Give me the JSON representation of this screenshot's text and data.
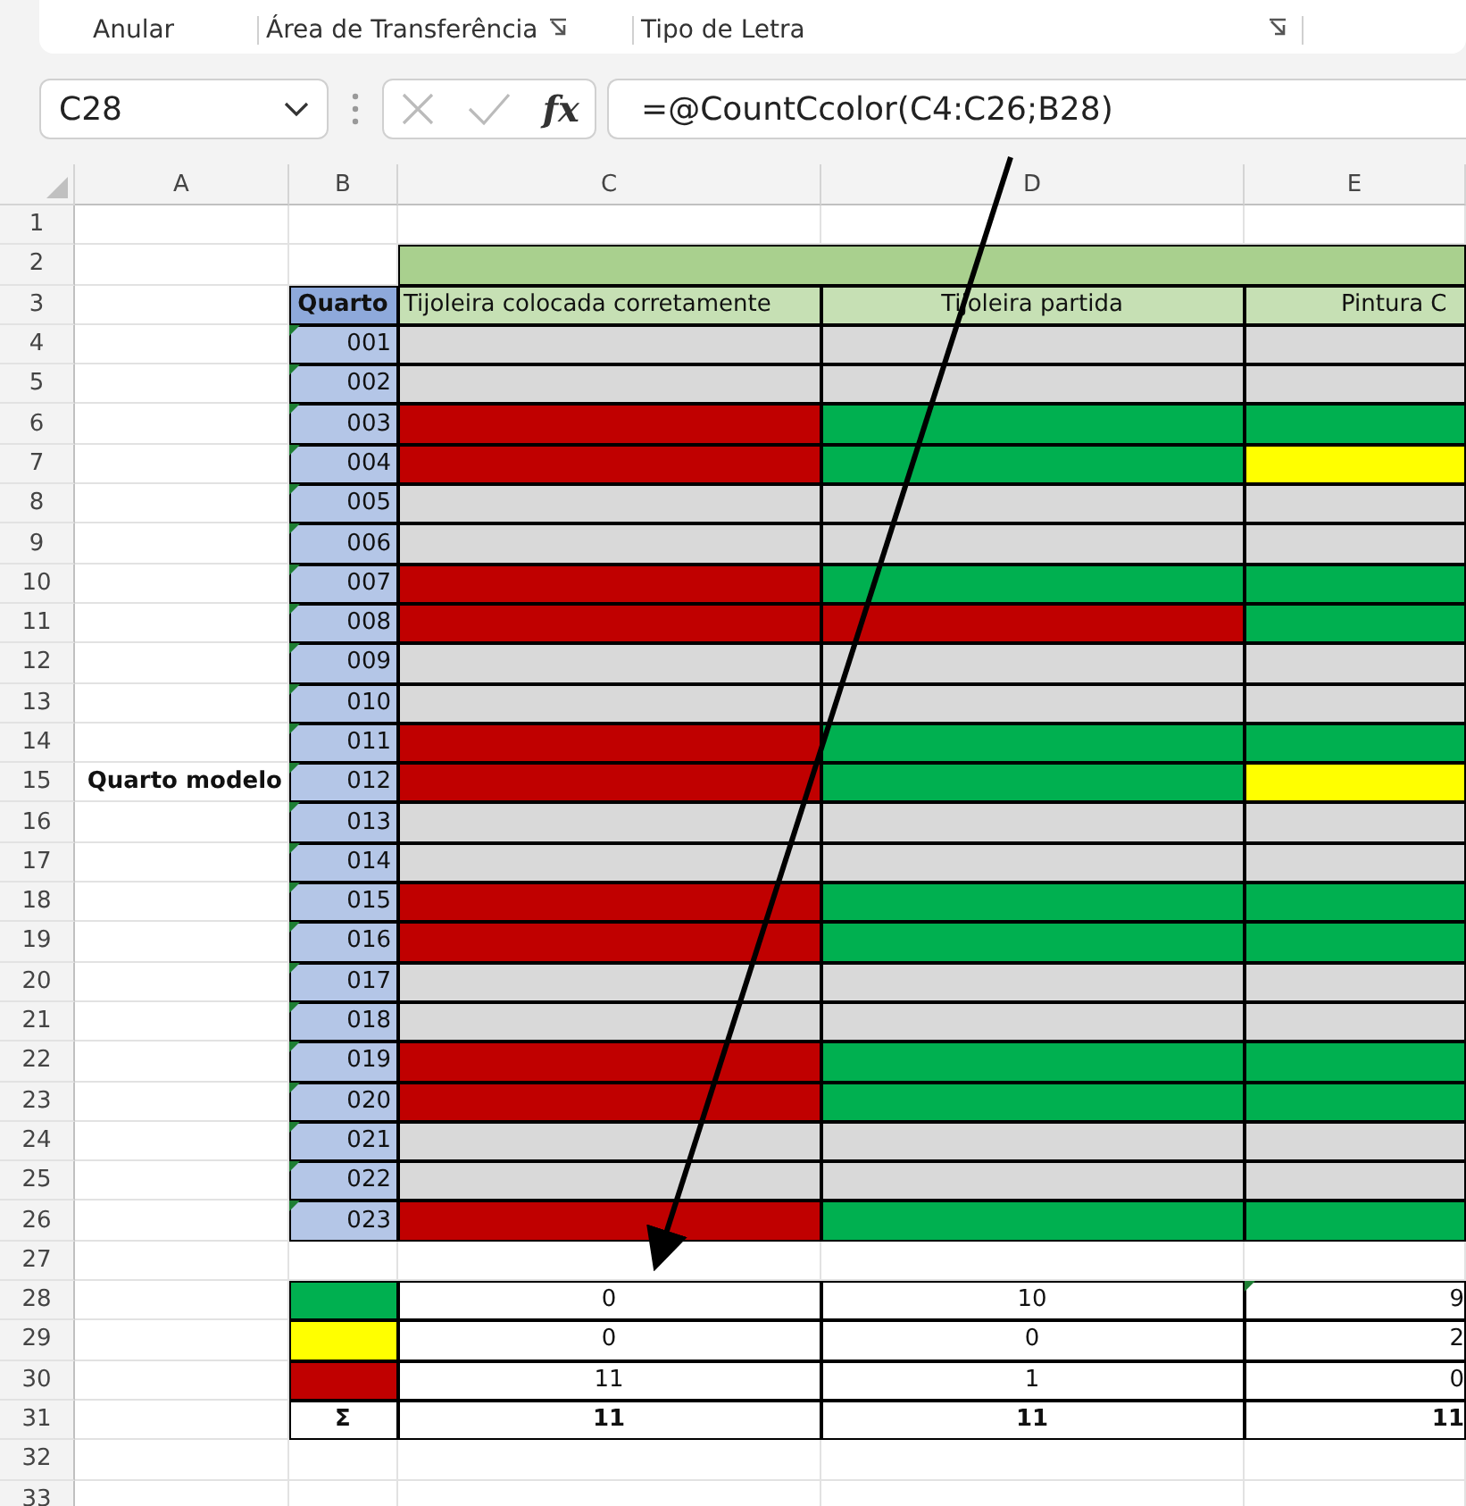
{
  "ribbon": {
    "groups": [
      {
        "label": "Anular",
        "launcher": false
      },
      {
        "label": "Área de Transferência",
        "launcher": true
      },
      {
        "label": "Tipo de Letra",
        "launcher": true
      }
    ]
  },
  "name_box": {
    "value": "C28"
  },
  "formula_bar": {
    "fx": "fx",
    "value": "=@CountCcolor(C4:C26;B28)"
  },
  "columns": [
    "A",
    "B",
    "C",
    "D",
    "E"
  ],
  "row_numbers": [
    "1",
    "2",
    "3",
    "4",
    "5",
    "6",
    "7",
    "8",
    "9",
    "10",
    "11",
    "12",
    "13",
    "14",
    "15",
    "16",
    "17",
    "18",
    "19",
    "20",
    "21",
    "22",
    "23",
    "24",
    "25",
    "26",
    "27",
    "28",
    "29",
    "30",
    "31",
    "32",
    "33"
  ],
  "sheet": {
    "room_header": "Quarto",
    "criteria": [
      "Tijoleira colocada corretamente",
      "Tijoleira partida",
      "Pintura C"
    ],
    "group_label": "Quarto modelo",
    "rooms": [
      {
        "number": "001",
        "cells": [
          {
            "color": "#d9d9d9"
          },
          {
            "color": "#d9d9d9"
          },
          {
            "color": "#d9d9d9"
          }
        ]
      },
      {
        "number": "002",
        "cells": [
          {
            "color": "#d9d9d9"
          },
          {
            "color": "#d9d9d9"
          },
          {
            "color": "#d9d9d9"
          }
        ]
      },
      {
        "number": "003",
        "cells": [
          {
            "color": "#c00000"
          },
          {
            "color": "#00b050"
          },
          {
            "color": "#00b050"
          }
        ]
      },
      {
        "number": "004",
        "cells": [
          {
            "color": "#c00000"
          },
          {
            "color": "#00b050"
          },
          {
            "color": "#ffff00"
          }
        ]
      },
      {
        "number": "005",
        "cells": [
          {
            "color": "#d9d9d9"
          },
          {
            "color": "#d9d9d9"
          },
          {
            "color": "#d9d9d9"
          }
        ]
      },
      {
        "number": "006",
        "cells": [
          {
            "color": "#d9d9d9"
          },
          {
            "color": "#d9d9d9"
          },
          {
            "color": "#d9d9d9"
          }
        ]
      },
      {
        "number": "007",
        "cells": [
          {
            "color": "#c00000"
          },
          {
            "color": "#00b050"
          },
          {
            "color": "#00b050"
          }
        ]
      },
      {
        "number": "008",
        "cells": [
          {
            "color": "#c00000"
          },
          {
            "color": "#c00000"
          },
          {
            "color": "#00b050"
          }
        ]
      },
      {
        "number": "009",
        "cells": [
          {
            "color": "#d9d9d9"
          },
          {
            "color": "#d9d9d9"
          },
          {
            "color": "#d9d9d9"
          }
        ]
      },
      {
        "number": "010",
        "cells": [
          {
            "color": "#d9d9d9"
          },
          {
            "color": "#d9d9d9"
          },
          {
            "color": "#d9d9d9"
          }
        ]
      },
      {
        "number": "011",
        "cells": [
          {
            "color": "#c00000"
          },
          {
            "color": "#00b050"
          },
          {
            "color": "#00b050"
          }
        ]
      },
      {
        "number": "012",
        "cells": [
          {
            "color": "#c00000"
          },
          {
            "color": "#00b050"
          },
          {
            "color": "#ffff00"
          }
        ]
      },
      {
        "number": "013",
        "cells": [
          {
            "color": "#d9d9d9"
          },
          {
            "color": "#d9d9d9"
          },
          {
            "color": "#d9d9d9"
          }
        ]
      },
      {
        "number": "014",
        "cells": [
          {
            "color": "#d9d9d9"
          },
          {
            "color": "#d9d9d9"
          },
          {
            "color": "#d9d9d9"
          }
        ]
      },
      {
        "number": "015",
        "cells": [
          {
            "color": "#c00000"
          },
          {
            "color": "#00b050"
          },
          {
            "color": "#00b050"
          }
        ]
      },
      {
        "number": "016",
        "cells": [
          {
            "color": "#c00000"
          },
          {
            "color": "#00b050"
          },
          {
            "color": "#00b050"
          }
        ]
      },
      {
        "number": "017",
        "cells": [
          {
            "color": "#d9d9d9"
          },
          {
            "color": "#d9d9d9"
          },
          {
            "color": "#d9d9d9"
          }
        ]
      },
      {
        "number": "018",
        "cells": [
          {
            "color": "#d9d9d9"
          },
          {
            "color": "#d9d9d9"
          },
          {
            "color": "#d9d9d9"
          }
        ]
      },
      {
        "number": "019",
        "cells": [
          {
            "color": "#c00000"
          },
          {
            "color": "#00b050"
          },
          {
            "color": "#00b050"
          }
        ]
      },
      {
        "number": "020",
        "cells": [
          {
            "color": "#c00000"
          },
          {
            "color": "#00b050"
          },
          {
            "color": "#00b050"
          }
        ]
      },
      {
        "number": "021",
        "cells": [
          {
            "color": "#d9d9d9"
          },
          {
            "color": "#d9d9d9"
          },
          {
            "color": "#d9d9d9"
          }
        ]
      },
      {
        "number": "022",
        "cells": [
          {
            "color": "#d9d9d9"
          },
          {
            "color": "#d9d9d9"
          },
          {
            "color": "#d9d9d9"
          }
        ]
      },
      {
        "number": "023",
        "cells": [
          {
            "color": "#c00000"
          },
          {
            "color": "#00b050"
          },
          {
            "color": "#00b050"
          }
        ]
      }
    ],
    "summary": [
      {
        "color": "#00b050",
        "values": [
          "0",
          "10",
          "9"
        ]
      },
      {
        "color": "#ffff00",
        "values": [
          "0",
          "0",
          "2"
        ]
      },
      {
        "color": "#c00000",
        "values": [
          "11",
          "1",
          "0"
        ]
      }
    ],
    "total": {
      "symbol": "Σ",
      "values": [
        "11",
        "11",
        "11"
      ]
    }
  }
}
